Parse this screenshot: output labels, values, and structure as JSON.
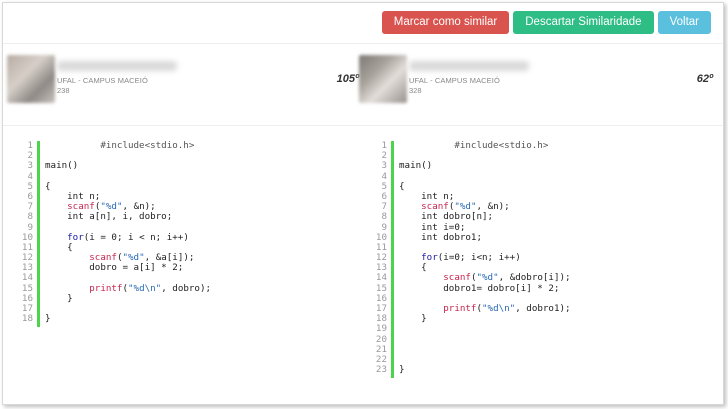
{
  "toolbar": {
    "mark_similar": "Marcar como similar",
    "discard_similarity": "Descartar Similaridade",
    "back": "Voltar"
  },
  "colors": {
    "danger": "#d9534f",
    "success": "#2ebd85",
    "info": "#5bc0de",
    "gutter_accent": "#4cd44c"
  },
  "students": [
    {
      "campus": "UFAL - CAMPUS MACEIÓ",
      "id": "238",
      "score": "105º"
    },
    {
      "campus": "UFAL - CAMPUS MACEIÓ",
      "id": "328",
      "score": "62º"
    }
  ],
  "code_left": [
    "          #include<stdio.h>",
    "",
    "main()",
    "",
    "{",
    "    int n;",
    "    scanf(\"%d\", &n);",
    "    int a[n], i, dobro;",
    "",
    "    for(i = 0; i < n; i++)",
    "    {",
    "        scanf(\"%d\", &a[i]);",
    "        dobro = a[i] * 2;",
    "",
    "        printf(\"%d\\n\", dobro);",
    "    }",
    "",
    "}"
  ],
  "code_right": [
    "          #include<stdio.h>",
    "",
    "main()",
    "",
    "{",
    "    int n;",
    "    scanf(\"%d\", &n);",
    "    int dobro[n];",
    "    int i=0;",
    "    int dobro1;",
    "",
    "    for(i=0; i<n; i++)",
    "    {",
    "        scanf(\"%d\", &dobro[i]);",
    "        dobro1= dobro[i] * 2;",
    "",
    "        printf(\"%d\\n\", dobro1);",
    "    }",
    "",
    "",
    "",
    "",
    "}"
  ]
}
